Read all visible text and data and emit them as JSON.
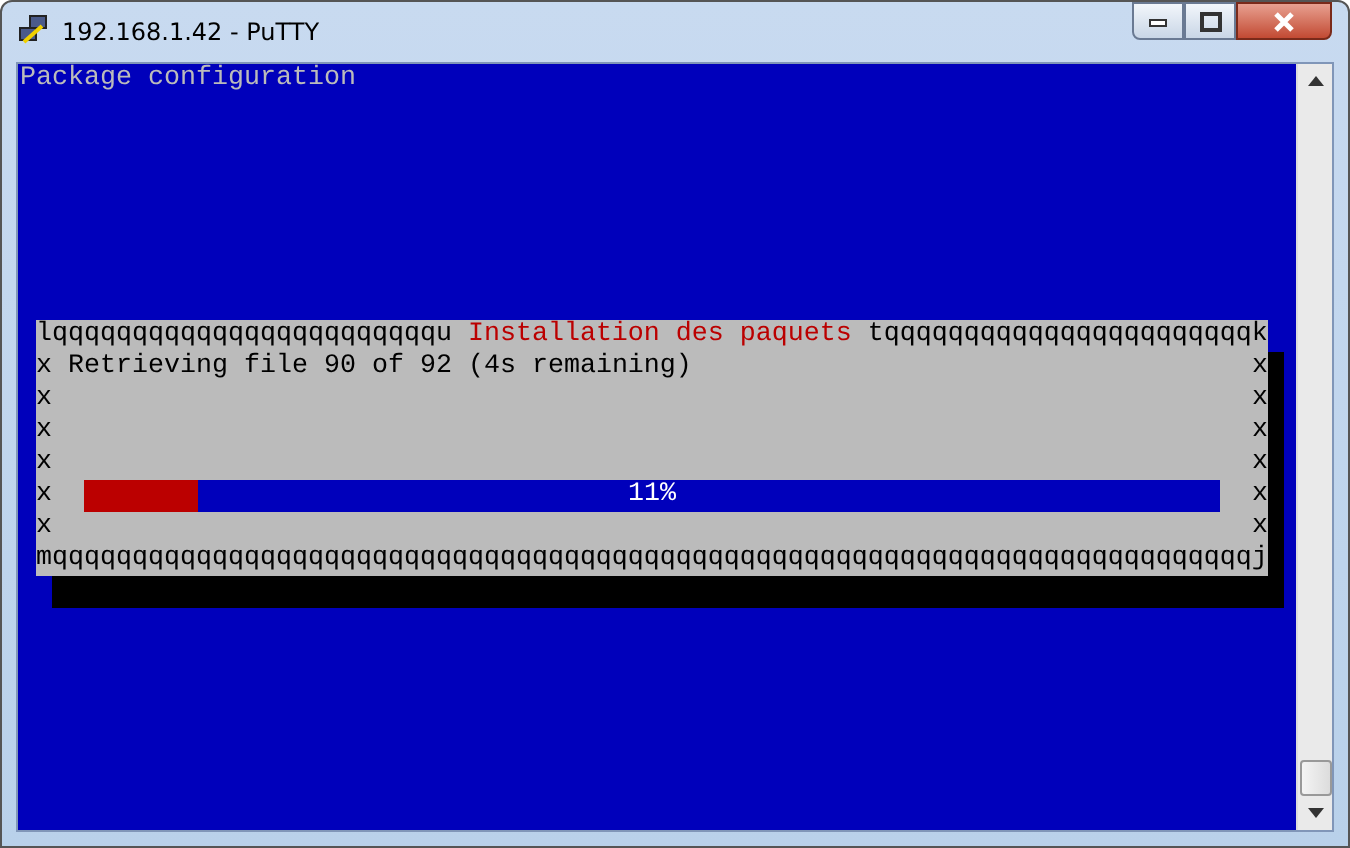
{
  "window": {
    "title": "192.168.1.42 - PuTTY"
  },
  "terminal": {
    "header": "Package configuration",
    "dialog": {
      "top_left": "lqqqqqqqqqqqqqqqqqqqqqqqqu",
      "title": "Installation des paquets",
      "top_right": "tqqqqqqqqqqqqqqqqqqqqqqqk",
      "rows": [
        {
          "kind": "text",
          "left": "x",
          "text": "Retrieving file 90 of 92 (4s remaining)",
          "right": "x"
        },
        {
          "kind": "text",
          "left": "x",
          "text": "",
          "right": "x"
        },
        {
          "kind": "text",
          "left": "x",
          "text": "",
          "right": "x"
        },
        {
          "kind": "text",
          "left": "x",
          "text": "",
          "right": "x"
        },
        {
          "kind": "progress",
          "left": "x",
          "level": 0.1,
          "label": "11%",
          "right": "x"
        },
        {
          "kind": "text",
          "left": "x",
          "text": "",
          "right": "x"
        }
      ],
      "bottom": "mqqqqqqqqqqqqqqqqqqqqqqqqqqqqqqqqqqqqqqqqqqqqqqqqqqqqqqqqqqqqqqqqqqqqqqqqqqqj"
    }
  }
}
